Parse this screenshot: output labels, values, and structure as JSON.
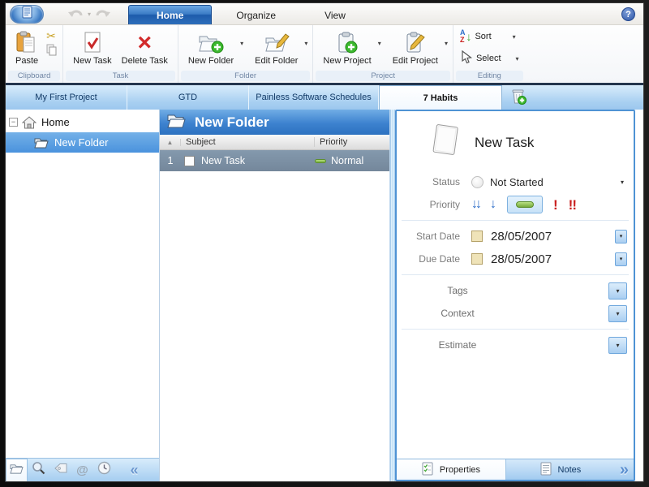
{
  "titlebar": {
    "tabs": [
      {
        "label": "Home"
      },
      {
        "label": "Organize"
      },
      {
        "label": "View"
      }
    ],
    "help_glyph": "?"
  },
  "ribbon": {
    "groups": [
      {
        "label": "Clipboard",
        "buttons": [
          {
            "label": "Paste"
          }
        ]
      },
      {
        "label": "Task",
        "buttons": [
          {
            "label": "New Task"
          },
          {
            "label": "Delete Task"
          }
        ]
      },
      {
        "label": "Folder",
        "buttons": [
          {
            "label": "New Folder"
          },
          {
            "label": "Edit Folder"
          }
        ]
      },
      {
        "label": "Project",
        "buttons": [
          {
            "label": "New Project"
          },
          {
            "label": "Edit Project"
          }
        ]
      },
      {
        "label": "Editing",
        "buttons": [
          {
            "label": "Sort"
          },
          {
            "label": "Select"
          }
        ]
      }
    ]
  },
  "project_tabs": {
    "tabs": [
      {
        "label": "My First Project"
      },
      {
        "label": "GTD"
      },
      {
        "label": "Painless Software Schedules"
      },
      {
        "label": "7 Habits",
        "active": true
      }
    ]
  },
  "sidebar": {
    "tree": [
      {
        "label": "Home"
      },
      {
        "label": "New Folder",
        "selected": true
      }
    ],
    "expander_glyph": "−"
  },
  "list_panel": {
    "header": "New Folder",
    "sort_glyph": "▲",
    "columns": {
      "subject": "Subject",
      "priority": "Priority"
    },
    "rows": [
      {
        "num": "1",
        "subject": "New Task",
        "priority": "Normal"
      }
    ]
  },
  "detail_panel": {
    "title": "New Task",
    "status_label": "Status",
    "status_value": "Not Started",
    "priority_label": "Priority",
    "start_date_label": "Start Date",
    "start_date_value": "28/05/2007",
    "due_date_label": "Due Date",
    "due_date_value": "28/05/2007",
    "tags_label": "Tags",
    "context_label": "Context",
    "estimate_label": "Estimate",
    "tabs": [
      {
        "label": "Properties",
        "active": true
      },
      {
        "label": "Notes"
      }
    ]
  },
  "glyphs": {
    "dropdown": "▾",
    "down_arrow": "↓",
    "double_down_arrow": "↓↓",
    "exclaim": "!",
    "double_exclaim": "!!",
    "scissors": "✂",
    "at_sign": "@",
    "delete_x": "×",
    "chevrons_right": "»",
    "chevrons_left": "«",
    "sort_a": "A",
    "sort_z": "Z"
  },
  "colors": {
    "accent_blue": "#2e72c2",
    "tab_strip_blue": "#a8cff1",
    "selected_row": "#7b91a6",
    "tree_selection": "#4a92dd",
    "priority_normal_green": "#76ab3c",
    "priority_low_blue": "#2f6fc9",
    "priority_high_red": "#c9201f",
    "panel_border": "#4f93d4"
  }
}
